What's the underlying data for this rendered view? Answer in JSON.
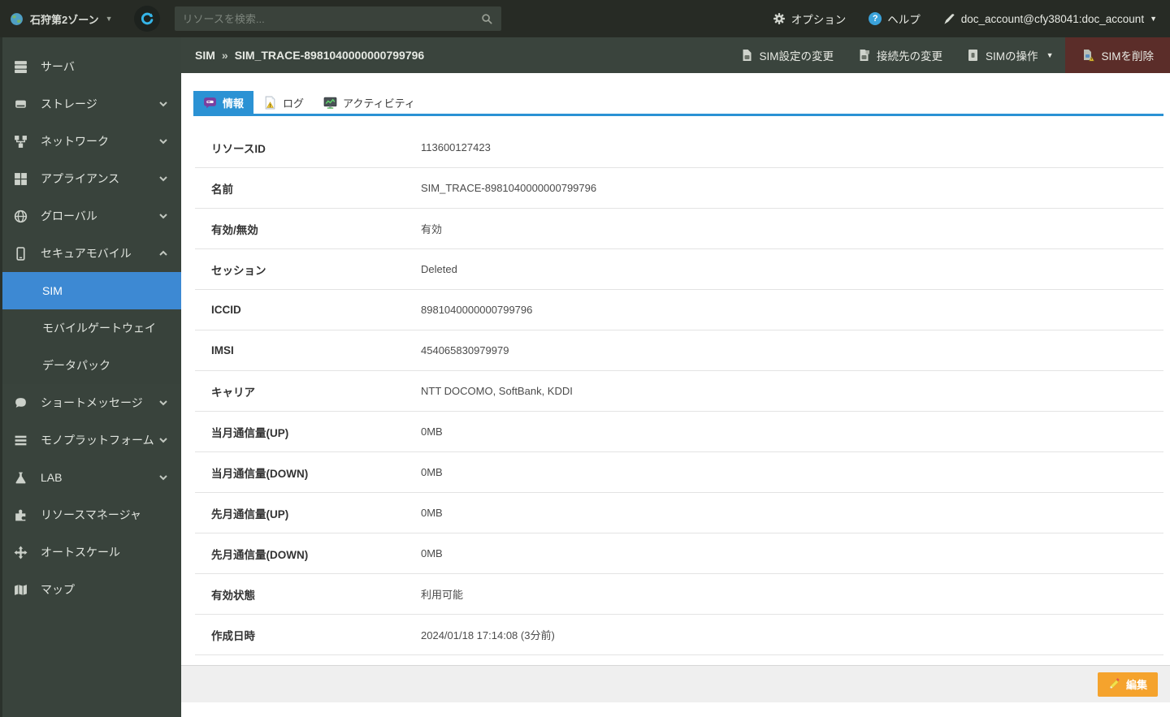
{
  "topbar": {
    "zone_label": "石狩第2ゾーン",
    "search_placeholder": "リソースを検索...",
    "options_label": "オプション",
    "help_label": "ヘルプ",
    "account_label": "doc_account@cfy38041:doc_account"
  },
  "colors": {
    "sidebar_bg": "#39433c",
    "topbar_bg": "#272b25",
    "active_item_blue": "#3d89d3",
    "tab_blue": "#2b92d4",
    "delete_red": "#5b2d29",
    "edit_orange": "#f5a32d"
  },
  "sidebar": {
    "items": [
      {
        "label": "サーバ",
        "icon": "server-icon"
      },
      {
        "label": "ストレージ",
        "icon": "storage-icon",
        "chevron": "down"
      },
      {
        "label": "ネットワーク",
        "icon": "network-icon",
        "chevron": "down"
      },
      {
        "label": "アプライアンス",
        "icon": "appliance-icon",
        "chevron": "down"
      },
      {
        "label": "グローバル",
        "icon": "globe-icon",
        "chevron": "down"
      },
      {
        "label": "セキュアモバイル",
        "icon": "mobile-icon",
        "chevron": "up",
        "expanded": true
      },
      {
        "label": "ショートメッセージ",
        "icon": "message-icon",
        "chevron": "down"
      },
      {
        "label": "モノプラットフォーム",
        "icon": "platform-icon",
        "chevron": "down"
      },
      {
        "label": "LAB",
        "icon": "lab-icon",
        "chevron": "down"
      },
      {
        "label": "リソースマネージャ",
        "icon": "puzzle-icon"
      },
      {
        "label": "オートスケール",
        "icon": "autoscale-icon"
      },
      {
        "label": "マップ",
        "icon": "map-icon"
      }
    ],
    "secure_mobile_submenu": [
      {
        "label": "SIM",
        "active": true
      },
      {
        "label": "モバイルゲートウェイ",
        "active": false
      },
      {
        "label": "データパック",
        "active": false
      }
    ]
  },
  "header": {
    "breadcrumb_section": "SIM",
    "breadcrumb_separator": "»",
    "breadcrumb_name": "SIM_TRACE-8981040000000799796",
    "actions": [
      {
        "label": "SIM設定の変更"
      },
      {
        "label": "接続先の変更"
      },
      {
        "label": "SIMの操作",
        "caret": "▼"
      },
      {
        "label": "SIMを削除",
        "style": "danger"
      }
    ]
  },
  "tabs": [
    {
      "label": "情報",
      "active": true
    },
    {
      "label": "ログ",
      "active": false
    },
    {
      "label": "アクティビティ",
      "active": false
    }
  ],
  "details": {
    "rows": [
      {
        "label": "リソースID",
        "value": "113600127423"
      },
      {
        "label": "名前",
        "value": "SIM_TRACE-8981040000000799796"
      },
      {
        "label": "有効/無効",
        "value": "有効"
      },
      {
        "label": "セッション",
        "value": "Deleted"
      },
      {
        "label": "ICCID",
        "value": "8981040000000799796"
      },
      {
        "label": "IMSI",
        "value": "454065830979979"
      },
      {
        "label": "キャリア",
        "value": "NTT DOCOMO, SoftBank, KDDI"
      },
      {
        "label": "当月通信量(UP)",
        "value": "0MB"
      },
      {
        "label": "当月通信量(DOWN)",
        "value": "0MB"
      },
      {
        "label": "先月通信量(UP)",
        "value": "0MB"
      },
      {
        "label": "先月通信量(DOWN)",
        "value": "0MB"
      },
      {
        "label": "有効状態",
        "value": "利用可能"
      },
      {
        "label": "作成日時",
        "value": "2024/01/18 17:14:08 (3分前)"
      }
    ]
  },
  "footer": {
    "edit_label": "編集"
  },
  "glyphs": {
    "caret_down": "▼"
  }
}
